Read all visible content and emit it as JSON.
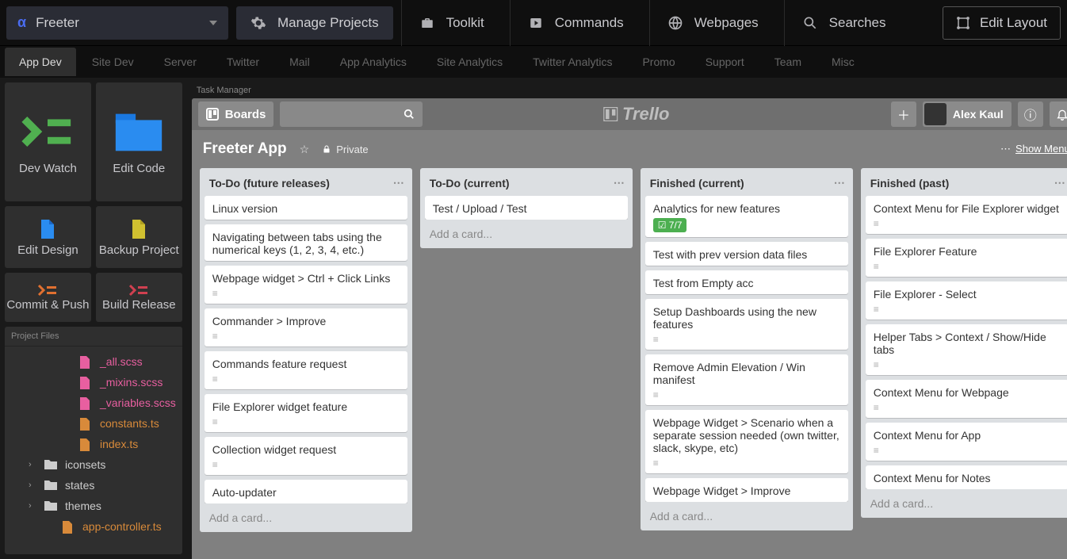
{
  "top": {
    "project": "Freeter",
    "manage": "Manage Projects",
    "menu": [
      {
        "label": "Toolkit"
      },
      {
        "label": "Commands"
      },
      {
        "label": "Webpages"
      },
      {
        "label": "Searches"
      }
    ],
    "edit_layout": "Edit Layout"
  },
  "tabs": [
    "App Dev",
    "Site Dev",
    "Server",
    "Twitter",
    "Mail",
    "App Analytics",
    "Site Analytics",
    "Twitter Analytics",
    "Promo",
    "Support",
    "Team",
    "Misc"
  ],
  "active_tab": 0,
  "tiles": {
    "dev_watch": "Dev Watch",
    "edit_code": "Edit Code",
    "edit_design": "Edit Design",
    "backup_project": "Backup Project",
    "commit_push": "Commit & Push",
    "build_release": "Build Release"
  },
  "file_panel": {
    "title": "Project Files",
    "items": [
      {
        "type": "file",
        "name": "_all.scss",
        "indent": 3,
        "cls": "file"
      },
      {
        "type": "file",
        "name": "_mixins.scss",
        "indent": 3,
        "cls": "file"
      },
      {
        "type": "file",
        "name": "_variables.scss",
        "indent": 3,
        "cls": "file"
      },
      {
        "type": "file",
        "name": "constants.ts",
        "indent": 3,
        "cls": "file-orange"
      },
      {
        "type": "file",
        "name": "index.ts",
        "indent": 3,
        "cls": "file-orange"
      },
      {
        "type": "folder",
        "name": "iconsets",
        "indent": 1
      },
      {
        "type": "folder",
        "name": "states",
        "indent": 1
      },
      {
        "type": "folder",
        "name": "themes",
        "indent": 1
      },
      {
        "type": "file",
        "name": "app-controller.ts",
        "indent": 2,
        "cls": "file-orange"
      }
    ]
  },
  "widget_title": "Task Manager",
  "trello": {
    "boards_btn": "Boards",
    "logo": "Trello",
    "user": "Alex Kaul",
    "board_title": "Freeter App",
    "private": "Private",
    "show_menu": "Show Menu",
    "lists": [
      {
        "title": "To-Do (future releases)",
        "cards": [
          {
            "text": "Linux version"
          },
          {
            "text": "Navigating between tabs using the numerical keys (1, 2, 3, 4, etc.)"
          },
          {
            "text": "Webpage widget > Ctrl + Click Links",
            "lines": true
          },
          {
            "text": "Commander > Improve",
            "lines": true
          },
          {
            "text": "Commands feature request",
            "lines": true
          },
          {
            "text": "File Explorer widget feature",
            "lines": true
          },
          {
            "text": "Collection widget request",
            "lines": true
          },
          {
            "text": "Auto-updater"
          }
        ],
        "add": "Add a card..."
      },
      {
        "title": "To-Do (current)",
        "cards": [
          {
            "text": "Test / Upload / Test"
          }
        ],
        "add": "Add a card..."
      },
      {
        "title": "Finished (current)",
        "cards": [
          {
            "text": "Analytics for new features",
            "badge": "7/7"
          },
          {
            "text": "Test with prev version data files"
          },
          {
            "text": "Test from Empty acc"
          },
          {
            "text": "Setup Dashboards using the new features",
            "lines": true
          },
          {
            "text": "Remove Admin Elevation / Win manifest",
            "lines": true
          },
          {
            "text": "Webpage Widget > Scenario when a separate session needed (own twitter, slack, skype, etc)",
            "lines": true
          },
          {
            "text": "Webpage Widget > Improve"
          }
        ],
        "add": "Add a card..."
      },
      {
        "title": "Finished (past)",
        "cards": [
          {
            "text": "Context Menu for File Explorer widget",
            "lines": true
          },
          {
            "text": "File Explorer Feature",
            "lines": true
          },
          {
            "text": "File Explorer - Select",
            "lines": true
          },
          {
            "text": "Helper Tabs > Context / Show/Hide tabs",
            "lines": true
          },
          {
            "text": "Context Menu for Webpage",
            "lines": true
          },
          {
            "text": "Context Menu for App",
            "lines": true
          },
          {
            "text": "Context Menu for Notes"
          }
        ],
        "add": "Add a card..."
      }
    ]
  }
}
